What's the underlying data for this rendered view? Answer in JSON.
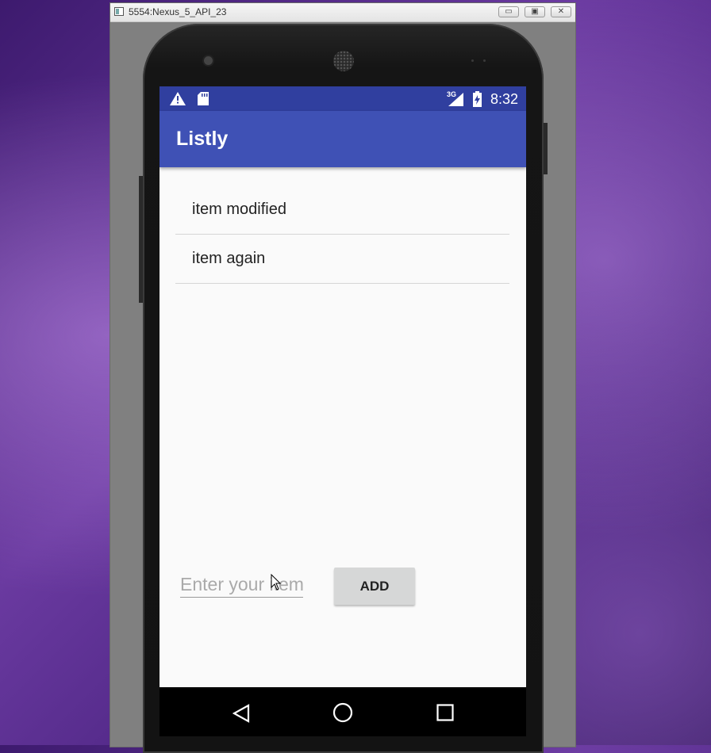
{
  "window": {
    "title": "5554:Nexus_5_API_23",
    "controls": [
      "minimize",
      "maximize",
      "close"
    ]
  },
  "statusbar": {
    "network": "3G",
    "time": "8:32",
    "icons": [
      "warning-icon",
      "sd-card-icon",
      "signal-icon",
      "battery-charging-icon"
    ]
  },
  "app": {
    "title": "Listly",
    "items": [
      "item modified",
      "item again"
    ],
    "input": {
      "placeholder": "Enter your item",
      "value": ""
    },
    "add_label": "ADD"
  },
  "navbar": {
    "icons": [
      "back-icon",
      "home-icon",
      "recents-icon"
    ]
  },
  "colors": {
    "statusbar": "#303f9f",
    "appbar": "#3f51b5",
    "button": "#d6d7d7"
  }
}
